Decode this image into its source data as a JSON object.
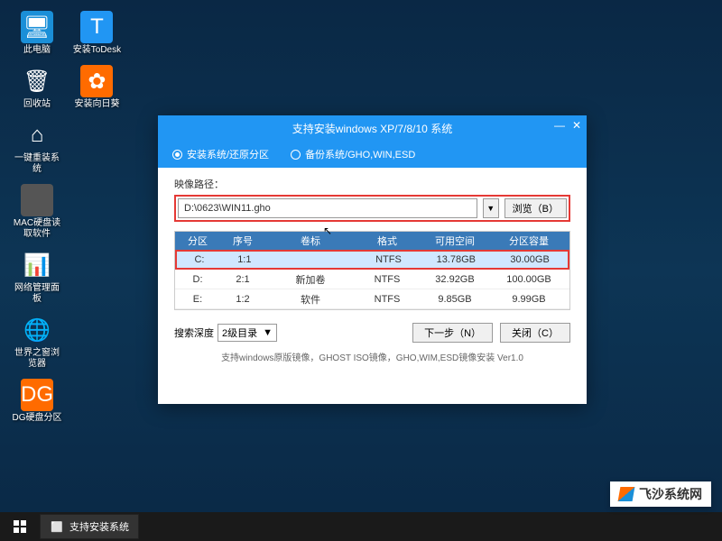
{
  "desktop": {
    "icons": [
      {
        "label": "此电脑",
        "name": "this-pc"
      },
      {
        "label": "安装ToDesk",
        "name": "install-todesk"
      },
      {
        "label": "回收站",
        "name": "recycle-bin"
      },
      {
        "label": "安装向日葵",
        "name": "install-sunflower"
      },
      {
        "label": "一键重装系统",
        "name": "one-click-reinstall"
      },
      {
        "label": "MAC硬盘读取软件",
        "name": "mac-disk-reader"
      },
      {
        "label": "网络管理面板",
        "name": "network-panel"
      },
      {
        "label": "世界之窗浏览器",
        "name": "browser"
      },
      {
        "label": "DG硬盘分区",
        "name": "dg-partition"
      }
    ]
  },
  "installer": {
    "title": "支持安装windows XP/7/8/10 系统",
    "option_install": "安装系统/还原分区",
    "option_backup": "备份系统/GHO,WIN,ESD",
    "path_label": "映像路径：",
    "path_value": "D:\\0623\\WIN11.gho",
    "browse_label": "浏览（B）",
    "table": {
      "headers": {
        "drive": "分区",
        "seq": "序号",
        "label": "卷标",
        "fs": "格式",
        "free": "可用空间",
        "total": "分区容量"
      },
      "rows": [
        {
          "drive": "C:",
          "seq": "1:1",
          "label": "",
          "fs": "NTFS",
          "free": "13.78GB",
          "total": "30.00GB"
        },
        {
          "drive": "D:",
          "seq": "2:1",
          "label": "新加卷",
          "fs": "NTFS",
          "free": "32.92GB",
          "total": "100.00GB"
        },
        {
          "drive": "E:",
          "seq": "1:2",
          "label": "软件",
          "fs": "NTFS",
          "free": "9.85GB",
          "total": "9.99GB"
        }
      ]
    },
    "search_depth_label": "搜索深度",
    "search_depth_value": "2级目录",
    "next_label": "下一步（N）",
    "close_label": "关闭（C）",
    "footer": "支持windows原版镜像，GHOST ISO镜像，GHO,WIM,ESD镜像安装 Ver1.0"
  },
  "taskbar": {
    "app_label": "支持安装系统"
  },
  "watermark": {
    "text": "飞沙系统网"
  }
}
